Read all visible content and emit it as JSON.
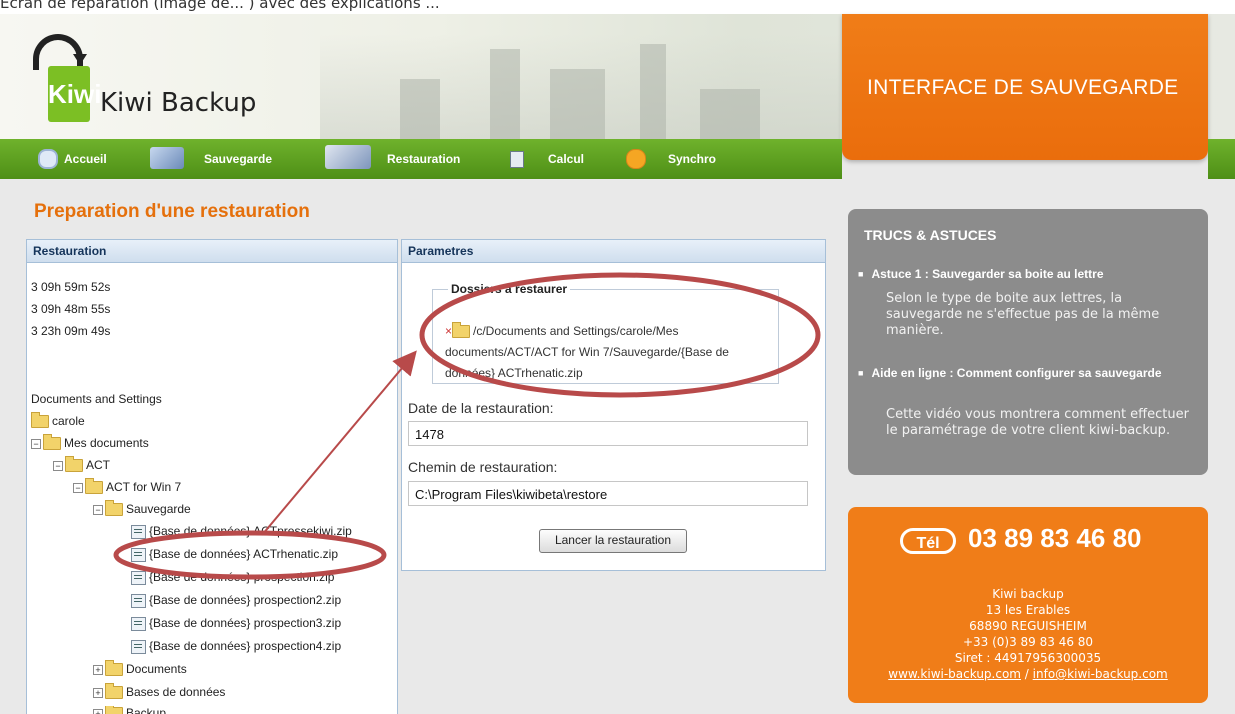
{
  "top_caption": "Ecran de réparation (image de... ) avec des explications ...",
  "header": {
    "brand": "Kiwi Backup",
    "logo_text": "Kiwi",
    "interface_title": "INTERFACE DE SAUVEGARDE"
  },
  "nav": {
    "items": [
      {
        "label": "Accueil",
        "icon": "home-icon"
      },
      {
        "label": "Sauvegarde",
        "icon": "computers-icon"
      },
      {
        "label": "Restauration",
        "icon": "restore-icon"
      },
      {
        "label": "Calcul",
        "icon": "calculator-icon"
      },
      {
        "label": "Synchro",
        "icon": "sync-icon"
      }
    ]
  },
  "page_title": "Preparation d'une restauration",
  "restauration_panel": {
    "title": "Restauration",
    "times": [
      "3 09h 59m 52s",
      "3 09h 48m 55s",
      "3 23h 09m 49s"
    ],
    "tree": [
      {
        "label": "Documents and Settings",
        "type": "text",
        "level": 0
      },
      {
        "label": "carole",
        "type": "folder",
        "level": 0
      },
      {
        "label": "Mes documents",
        "type": "folder",
        "level": 0,
        "exp": "−"
      },
      {
        "label": "ACT",
        "type": "folder",
        "level": 1,
        "exp": "−"
      },
      {
        "label": "ACT for Win 7",
        "type": "folder",
        "level": 2,
        "exp": "−"
      },
      {
        "label": "Sauvegarde",
        "type": "folder",
        "level": 3,
        "exp": "−"
      },
      {
        "label": "{Base de données} ACTpressekiwi.zip",
        "type": "zip",
        "level": 4
      },
      {
        "label": "{Base de données} ACTrhenatic.zip",
        "type": "zip",
        "level": 4
      },
      {
        "label": "{Base de données} prospection.zip",
        "type": "zip",
        "level": 4
      },
      {
        "label": "{Base de données} prospection2.zip",
        "type": "zip",
        "level": 4
      },
      {
        "label": "{Base de données} prospection3.zip",
        "type": "zip",
        "level": 4
      },
      {
        "label": "{Base de données} prospection4.zip",
        "type": "zip",
        "level": 4
      },
      {
        "label": "Documents",
        "type": "folder",
        "level": 3,
        "exp": "+"
      },
      {
        "label": "Bases de données",
        "type": "folder",
        "level": 3,
        "exp": "+"
      },
      {
        "label": "Backup",
        "type": "folder",
        "level": 3,
        "exp": "+"
      }
    ]
  },
  "parametres_panel": {
    "title": "Parametres",
    "fieldset_legend": "Dossiers à restaurer",
    "folder_path_line1": "/c/Documents and Settings/carole/Mes",
    "folder_path_line2": "documents/ACT/ACT for Win 7/Sauvegarde/{Base de",
    "folder_path_line3": "données} ACTrhenatic.zip",
    "remove_glyph": "×",
    "date_label": "Date de la restauration:",
    "date_value": "1478",
    "path_label": "Chemin de restauration:",
    "path_value": "C:\\Program Files\\kiwibeta\\restore",
    "launch_button": "Lancer la restauration"
  },
  "tips": {
    "title": "TRUCS & ASTUCES",
    "tip1_title": "Astuce 1 : Sauvegarder sa boite au lettre",
    "tip1_text": "Selon le type de boite aux lettres, la sauvegarde ne s'effectue pas de la même manière.",
    "tip2_title": "Aide en ligne : Comment configurer sa sauvegarde",
    "tip2_text": "Cette vidéo vous montrera comment effectuer le paramétrage de votre client kiwi-backup."
  },
  "contact": {
    "tel_badge": "Tél",
    "phone": "03 89 83 46 80",
    "company": "Kiwi backup",
    "street": "13 les Erables",
    "city": "68890 REGUISHEIM",
    "phone_intl": "+33 (0)3 89 83 46 80",
    "siret": "Siret : 44917956300035",
    "website": "www.kiwi-backup.com",
    "separator": " / ",
    "email": "info@kiwi-backup.com"
  },
  "colors": {
    "orange": "#f07d18",
    "green": "#5fa21f",
    "annotation_red": "#b84a4a",
    "title_orange": "#e5700c"
  }
}
